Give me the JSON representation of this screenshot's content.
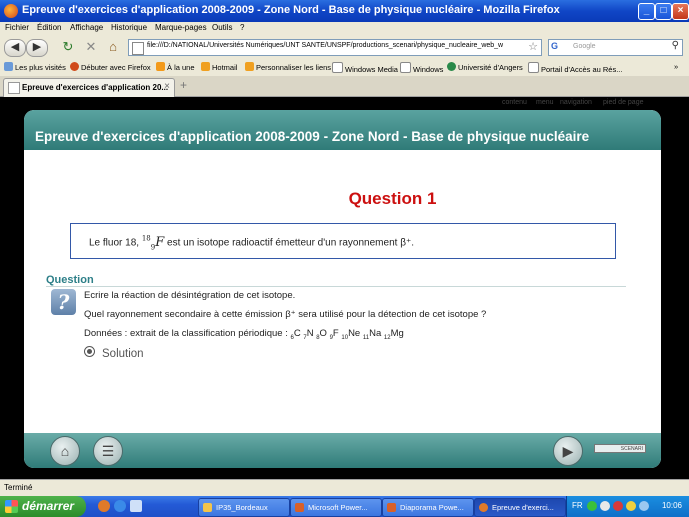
{
  "window": {
    "title": "Epreuve d'exercices d'application 2008-2009 - Zone Nord - Base de physique nucléaire - Mozilla Firefox"
  },
  "menu": [
    "Fichier",
    "Édition",
    "Affichage",
    "Historique",
    "Marque-pages",
    "Outils",
    "?"
  ],
  "navbar": {
    "url": "file:///D:/NATIONAL/Universités Numériques/UNT SANTE/UNSPF/productions_scenari/physique_nucleaire_web_w",
    "search_placeholder": "Google",
    "search_engine": "G"
  },
  "bookmarks": [
    "Les plus visités",
    "Débuter avec Firefox",
    "À la une",
    "Hotmail",
    "Personnaliser les liens",
    "Windows Media",
    "Windows",
    "Université d'Angers",
    "Portail d'Accès au Rés..."
  ],
  "tab": {
    "title": "Epreuve d'exercices d'application 20..."
  },
  "page": {
    "top_links": [
      "contenu",
      "menu",
      "navigation",
      "pied de page"
    ],
    "header_title": "Epreuve d'exercices d'application 2008-2009 - Zone Nord - Base de physique nucléaire",
    "question_title": "Question 1",
    "statement_before": "Le fluor 18,",
    "isotope": {
      "mass": "18",
      "atomic": "9",
      "symbol": "F"
    },
    "statement_after": "est un isotope radioactif émetteur d'un rayonnement β⁺.",
    "question_label": "Question",
    "question_icon": "?",
    "lines": [
      "Ecrire la réaction de désintégration de cet isotope.",
      "Quel rayonnement secondaire à cette émission β⁺ sera utilisé pour la détection de cet isotope ?"
    ],
    "data_prefix": "Données : extrait de la classification périodique :",
    "elements": [
      {
        "z": "6",
        "sym": "C"
      },
      {
        "z": "7",
        "sym": "N"
      },
      {
        "z": "8",
        "sym": "O"
      },
      {
        "z": "9",
        "sym": "F"
      },
      {
        "z": "10",
        "sym": "Ne"
      },
      {
        "z": "11",
        "sym": "Na"
      },
      {
        "z": "12",
        "sym": "Mg"
      }
    ],
    "solution_label": "Solution",
    "footer_badge": "SCENARI"
  },
  "status": "Terminé",
  "taskbar": {
    "start": "démarrer",
    "tasks": [
      "IP35_Bordeaux",
      "Microsoft Power...",
      "Diaporama Powe...",
      "Epreuve d'exerci..."
    ],
    "lang": "FR",
    "clock": "10:06"
  }
}
